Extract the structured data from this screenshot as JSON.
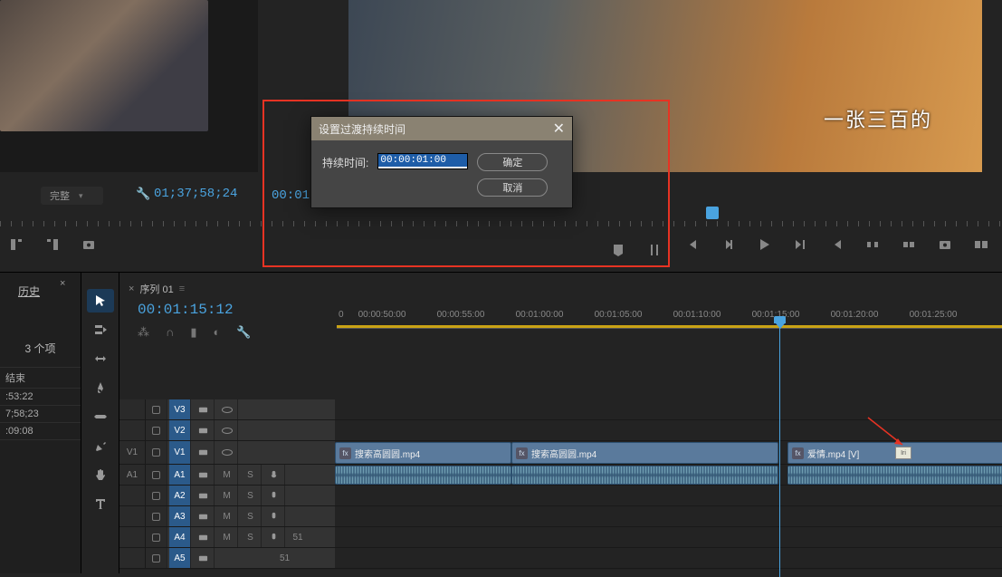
{
  "source": {
    "fit_label": "完整",
    "timecode": "01;37;58;24"
  },
  "program": {
    "subtitle": "一张三百的",
    "timecode": "00:01:",
    "marker_time": "00:01:15:12"
  },
  "history": {
    "tab": "历史",
    "count": "3 个项",
    "col_header": "结束",
    "rows": [
      ":53:22",
      "7;58;23",
      ":09:08"
    ]
  },
  "sequence": {
    "tab_name": "序列 01",
    "playhead_time": "00:01:15:12"
  },
  "ruler": {
    "labels": [
      "0",
      "00:00:50:00",
      "00:00:55:00",
      "00:01:00:00",
      "00:01:05:00",
      "00:01:10:00",
      "00:01:15:00",
      "00:01:20:00",
      "00:01:25:00"
    ]
  },
  "tracks": {
    "video": [
      "V3",
      "V2",
      "V1"
    ],
    "audio": [
      "A1",
      "A2",
      "A3",
      "A4",
      "A5"
    ],
    "src_v": "V1",
    "src_a": "A1",
    "mix_label_1": "51",
    "mix_label_2": "51"
  },
  "clips": {
    "v1a_label": "搜索高圆圆.mp4",
    "v1b_label": "搜索高圆圆.mp4",
    "v1c_label": "爱情.mp4 [V]",
    "trans_label": "Iri"
  },
  "dialog": {
    "title": "设置过渡持续时间",
    "label": "持续时间:",
    "value": "00:00:01:00",
    "ok": "确定",
    "cancel": "取消"
  }
}
